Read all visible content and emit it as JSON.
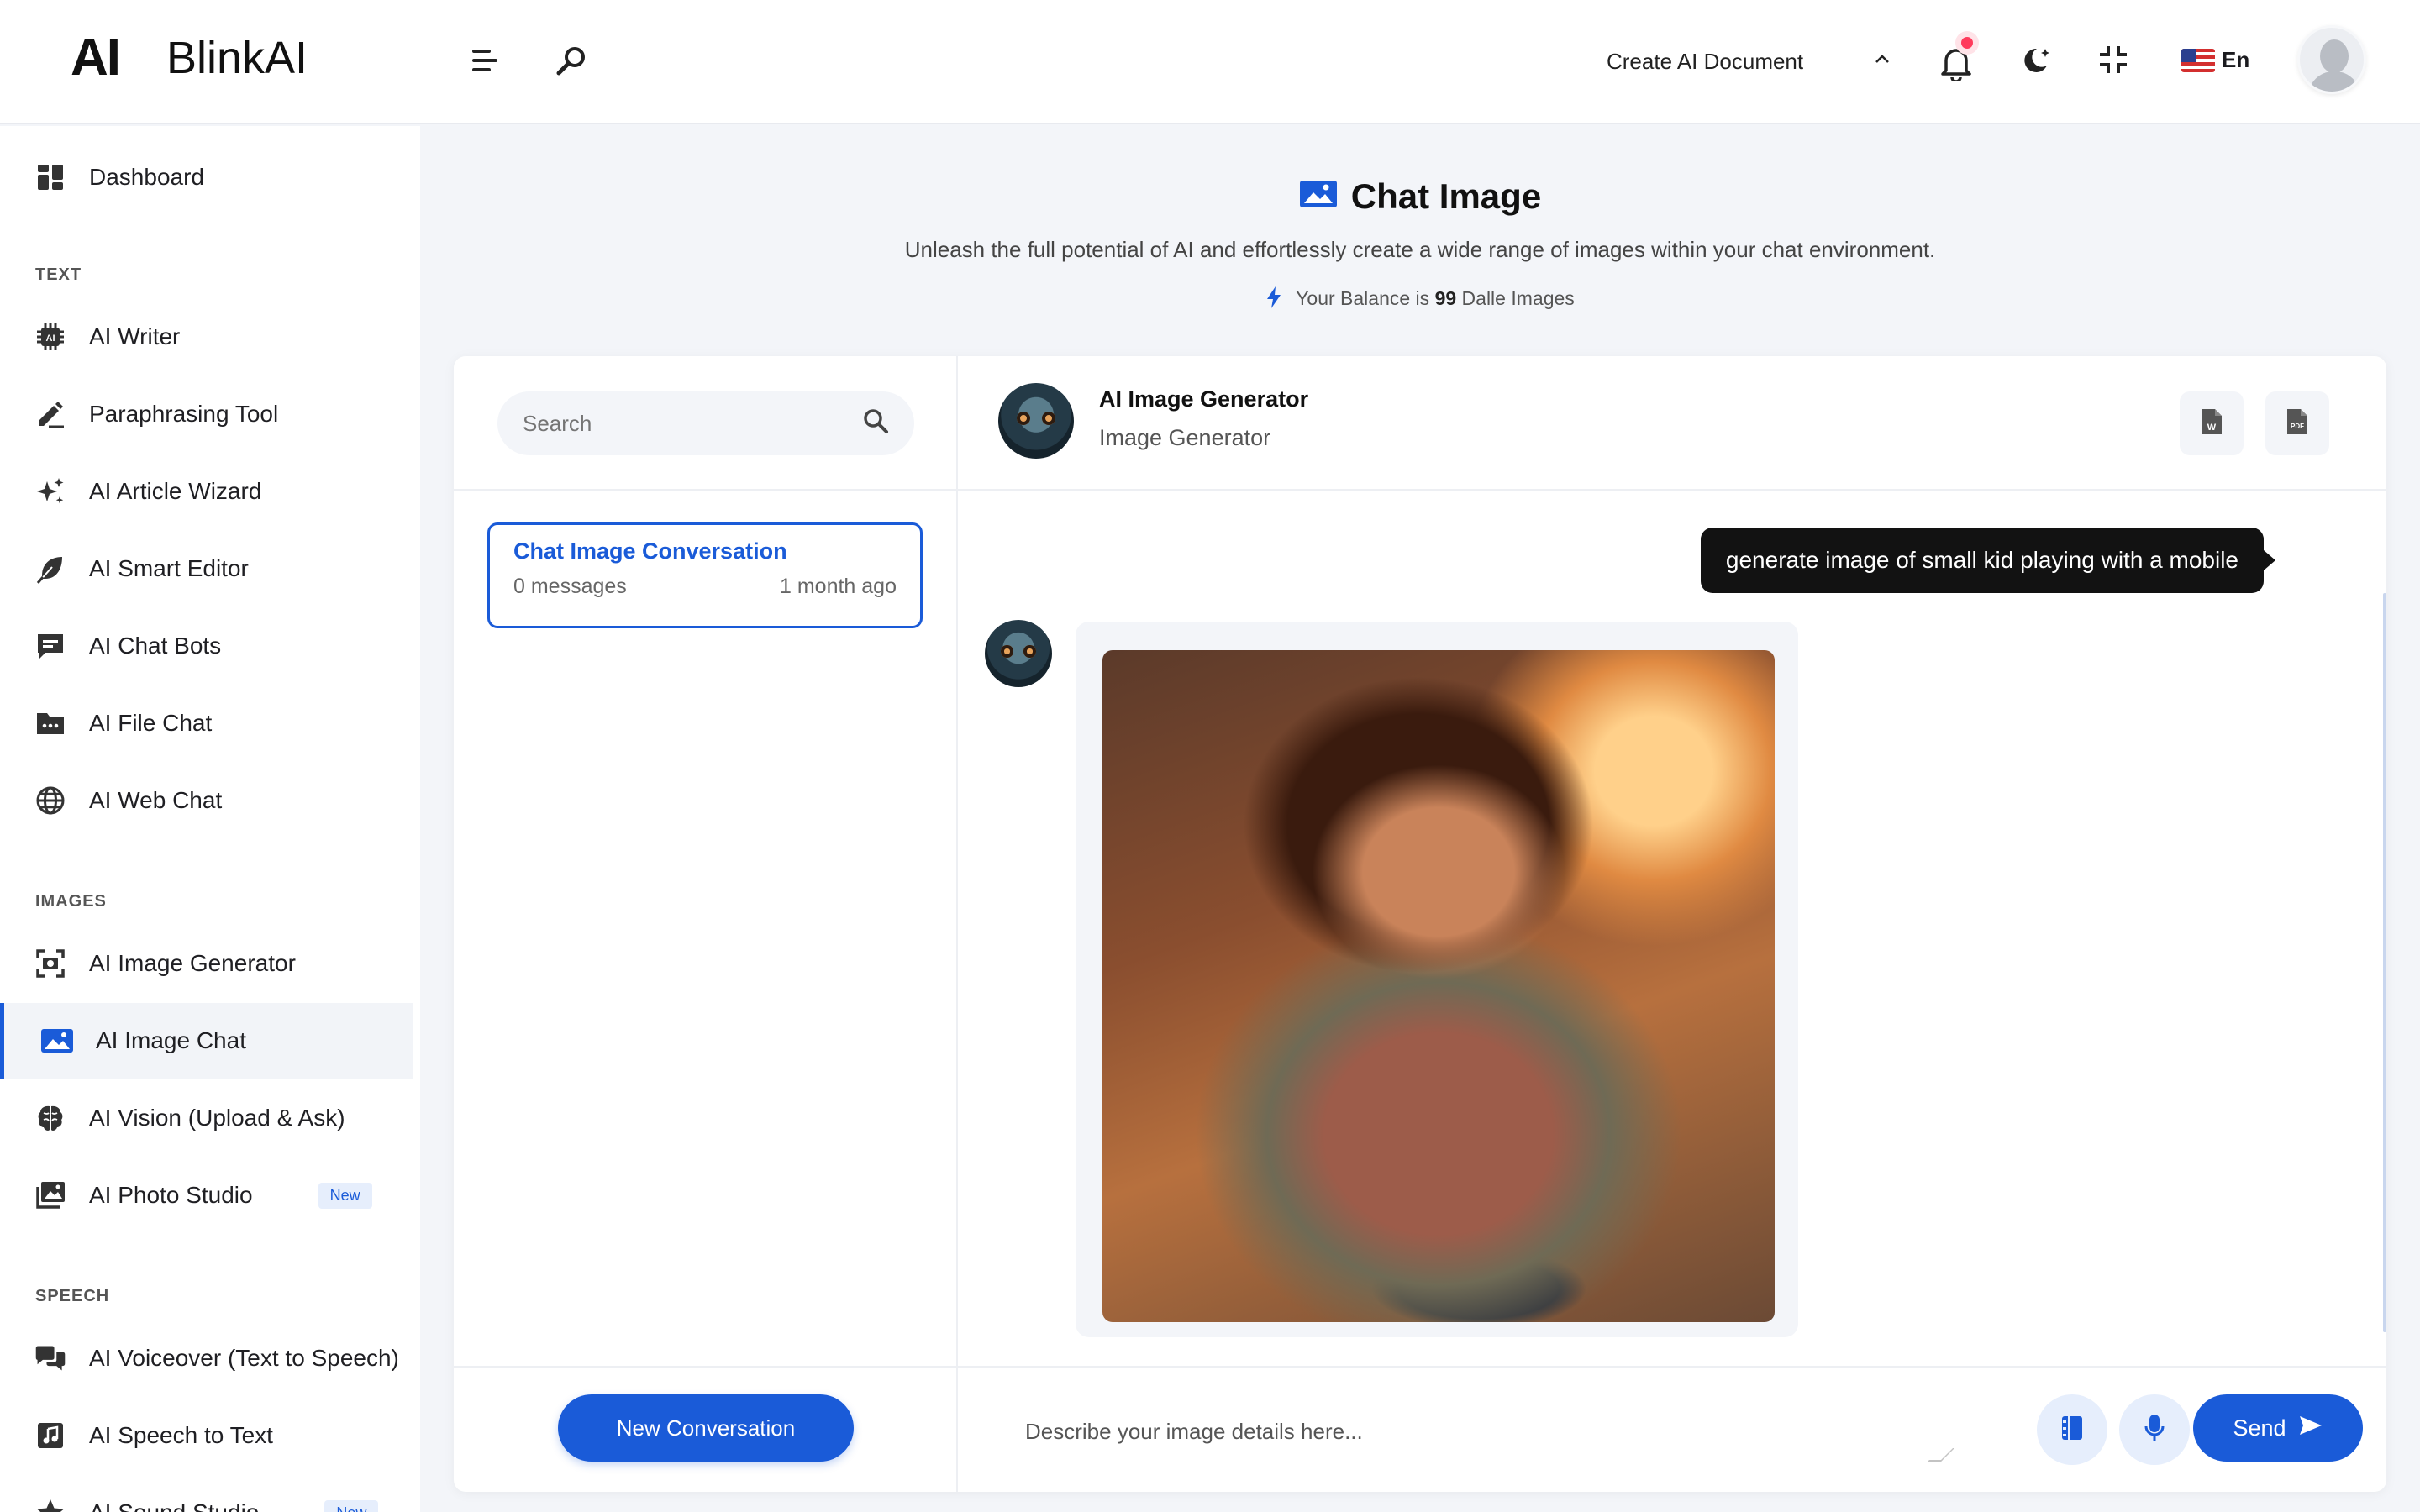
{
  "brand": {
    "mark": "AI",
    "name": "BlinkAI"
  },
  "header": {
    "create_document_label": "Create AI Document",
    "language_label": "En"
  },
  "sidebar": {
    "dashboard": "Dashboard",
    "sections": {
      "text": "TEXT",
      "images": "IMAGES",
      "speech": "SPEECH"
    },
    "text_items": [
      {
        "label": "AI Writer",
        "icon": "ai-chip-icon"
      },
      {
        "label": "Paraphrasing Tool",
        "icon": "pencil-icon"
      },
      {
        "label": "AI Article Wizard",
        "icon": "sparkles-icon"
      },
      {
        "label": "AI Smart Editor",
        "icon": "feather-icon"
      },
      {
        "label": "AI Chat Bots",
        "icon": "chat-bubble-icon"
      },
      {
        "label": "AI File Chat",
        "icon": "folder-icon"
      },
      {
        "label": "AI Web Chat",
        "icon": "globe-icon"
      }
    ],
    "image_items": [
      {
        "label": "AI Image Generator",
        "icon": "camera-frame-icon"
      },
      {
        "label": "AI Image Chat",
        "icon": "image-icon",
        "active": true
      },
      {
        "label": "AI Vision (Upload & Ask)",
        "icon": "brain-icon"
      },
      {
        "label": "AI Photo Studio",
        "icon": "photos-icon",
        "badge": "New"
      }
    ],
    "speech_items": [
      {
        "label": "AI Voiceover (Text to Speech)",
        "icon": "speech-bubbles-icon"
      },
      {
        "label": "AI Speech to Text",
        "icon": "music-note-icon"
      },
      {
        "label": "AI Sound Studio",
        "icon": "star-icon",
        "badge": "New"
      }
    ]
  },
  "page": {
    "title": "Chat Image",
    "subtitle": "Unleash the full potential of AI and effortlessly create a wide range of images within your chat environment.",
    "balance_prefix": "Your Balance is",
    "balance_value": "99",
    "balance_suffix": "Dalle Images"
  },
  "conversations": {
    "search_placeholder": "Search",
    "items": [
      {
        "title": "Chat Image Conversation",
        "messages": "0 messages",
        "time": "1 month ago"
      }
    ],
    "new_button": "New Conversation"
  },
  "chat": {
    "bot_name": "AI Image Generator",
    "bot_role": "Image Generator",
    "user_message": "generate image of small kid playing with a mobile",
    "input_placeholder": "Describe your image details here...",
    "send_label": "Send"
  },
  "colors": {
    "accent": "#1a5bd8",
    "user_bubble": "#121212",
    "notification_dot": "#ff3b5c"
  }
}
